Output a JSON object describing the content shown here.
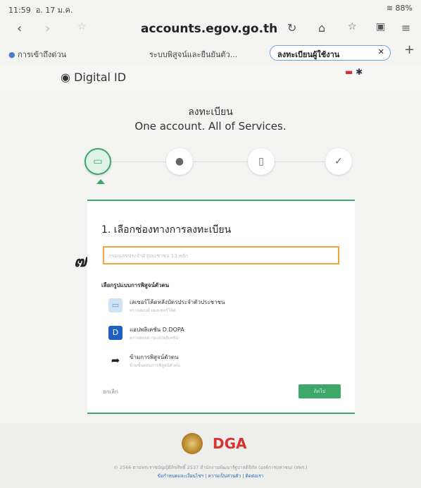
{
  "status_bar": {
    "time": "11:59",
    "date": "อ. 17 ม.ค.",
    "battery": "88%"
  },
  "browser": {
    "url": "accounts.egov.go.th"
  },
  "tabs": [
    {
      "label": "การเข้าถึงด่วน"
    },
    {
      "label": "ระบบพิสูจน์และยืนยันตัว..."
    },
    {
      "label": "ลงทะเบียนผู้ใช้งาน"
    }
  ],
  "header": {
    "brand": "Digital ID"
  },
  "register": {
    "title": "ลงทะเบียน",
    "subtitle": "One account. All of Services."
  },
  "steps": [
    {
      "icon": "card-icon"
    },
    {
      "icon": "user-icon"
    },
    {
      "icon": "phone-icon"
    },
    {
      "icon": "check-icon"
    }
  ],
  "form": {
    "section_title": "1. เลือกช่องทางการลงทะเบียน",
    "annotation": "๗.",
    "input_placeholder": "กรอกเลขประจำตัวประชาชน 13 หลัก",
    "options_title": "เลือกรูปแบบการพิสูจน์ตัวตน",
    "options": [
      {
        "label": "เลเซอร์โค้ดหลังบัตรประจำตัวประชาชน",
        "sub": "ตรวจสอบด้วยเลเซอร์โค้ด",
        "icon": "id-card-icon"
      },
      {
        "label": "แอปพลิเคชัน D.DOPA",
        "sub": "ตรวจสอบผ่านแอปพลิเคชัน",
        "icon": "d-dopa-icon",
        "icon_text": "D"
      },
      {
        "label": "ข้ามการพิสูจน์ตัวตน",
        "sub": "ข้ามขั้นตอนการพิสูจน์ตัวตน",
        "icon": "skip-arrow-icon"
      }
    ],
    "cancel_label": "ยกเลิก",
    "next_label": "ถัดไป"
  },
  "footer": {
    "logo_text": "DGA",
    "copyright": "© 2566 ตามพระราชบัญญัติลิขสิทธิ์ 2537 สำนักงานพัฒนารัฐบาลดิจิทัล (องค์การมหาชน) (สพร.)",
    "links": "ข้อกำหนดและเงื่อนไขฯ | ความเป็นส่วนตัว | ติดต่อเรา"
  }
}
